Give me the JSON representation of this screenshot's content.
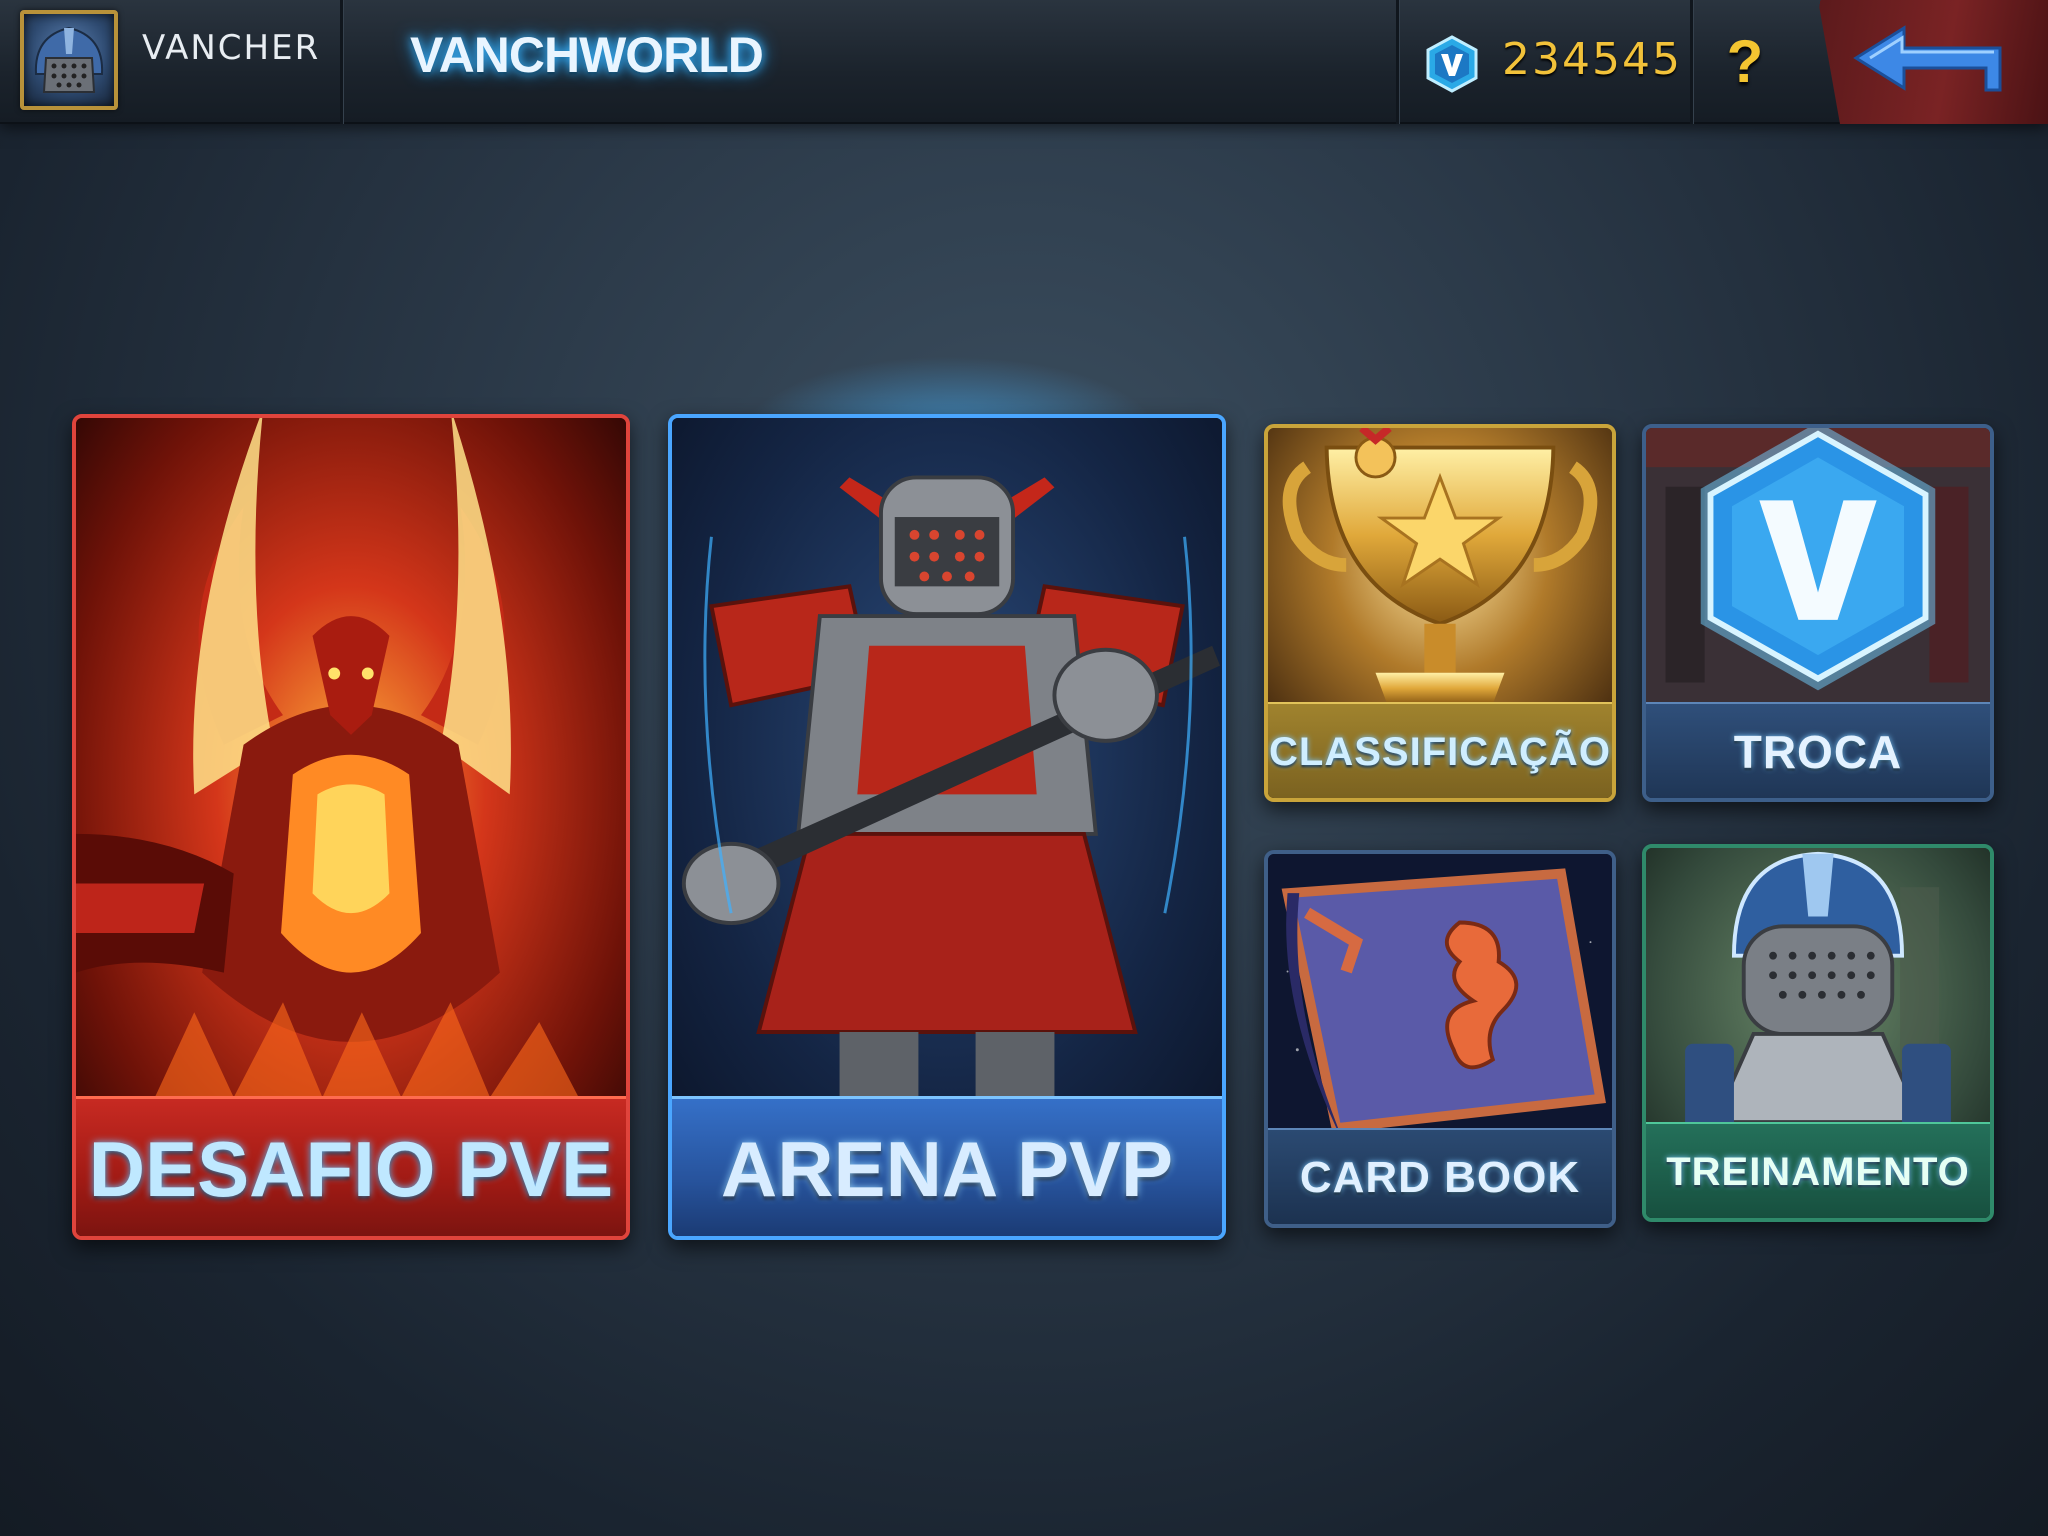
{
  "header": {
    "player_name": "VANCHER",
    "game_title": "VANCHWORLD",
    "currency_value": "234545",
    "help_label": "?"
  },
  "modes": {
    "pve_label": "DESAFIO PVE",
    "pvp_label": "ARENA PVP",
    "ranking_label": "CLASSIFICAÇÃO",
    "exchange_label": "TROCA",
    "cardbook_label": "CARD BOOK",
    "training_label": "TREINAMENTO"
  },
  "icons": {
    "avatar": "knight-helmet-avatar",
    "currency": "v-gem-icon",
    "back": "back-arrow-icon"
  },
  "colors": {
    "pve_accent": "#e0443c",
    "pvp_accent": "#4aa6ff",
    "ranking_accent": "#c9a43a",
    "exchange_accent": "#3d5f8a",
    "cardbook_accent": "#3f5f88",
    "training_accent": "#2f8a6a",
    "currency_text": "#f2c23a"
  }
}
